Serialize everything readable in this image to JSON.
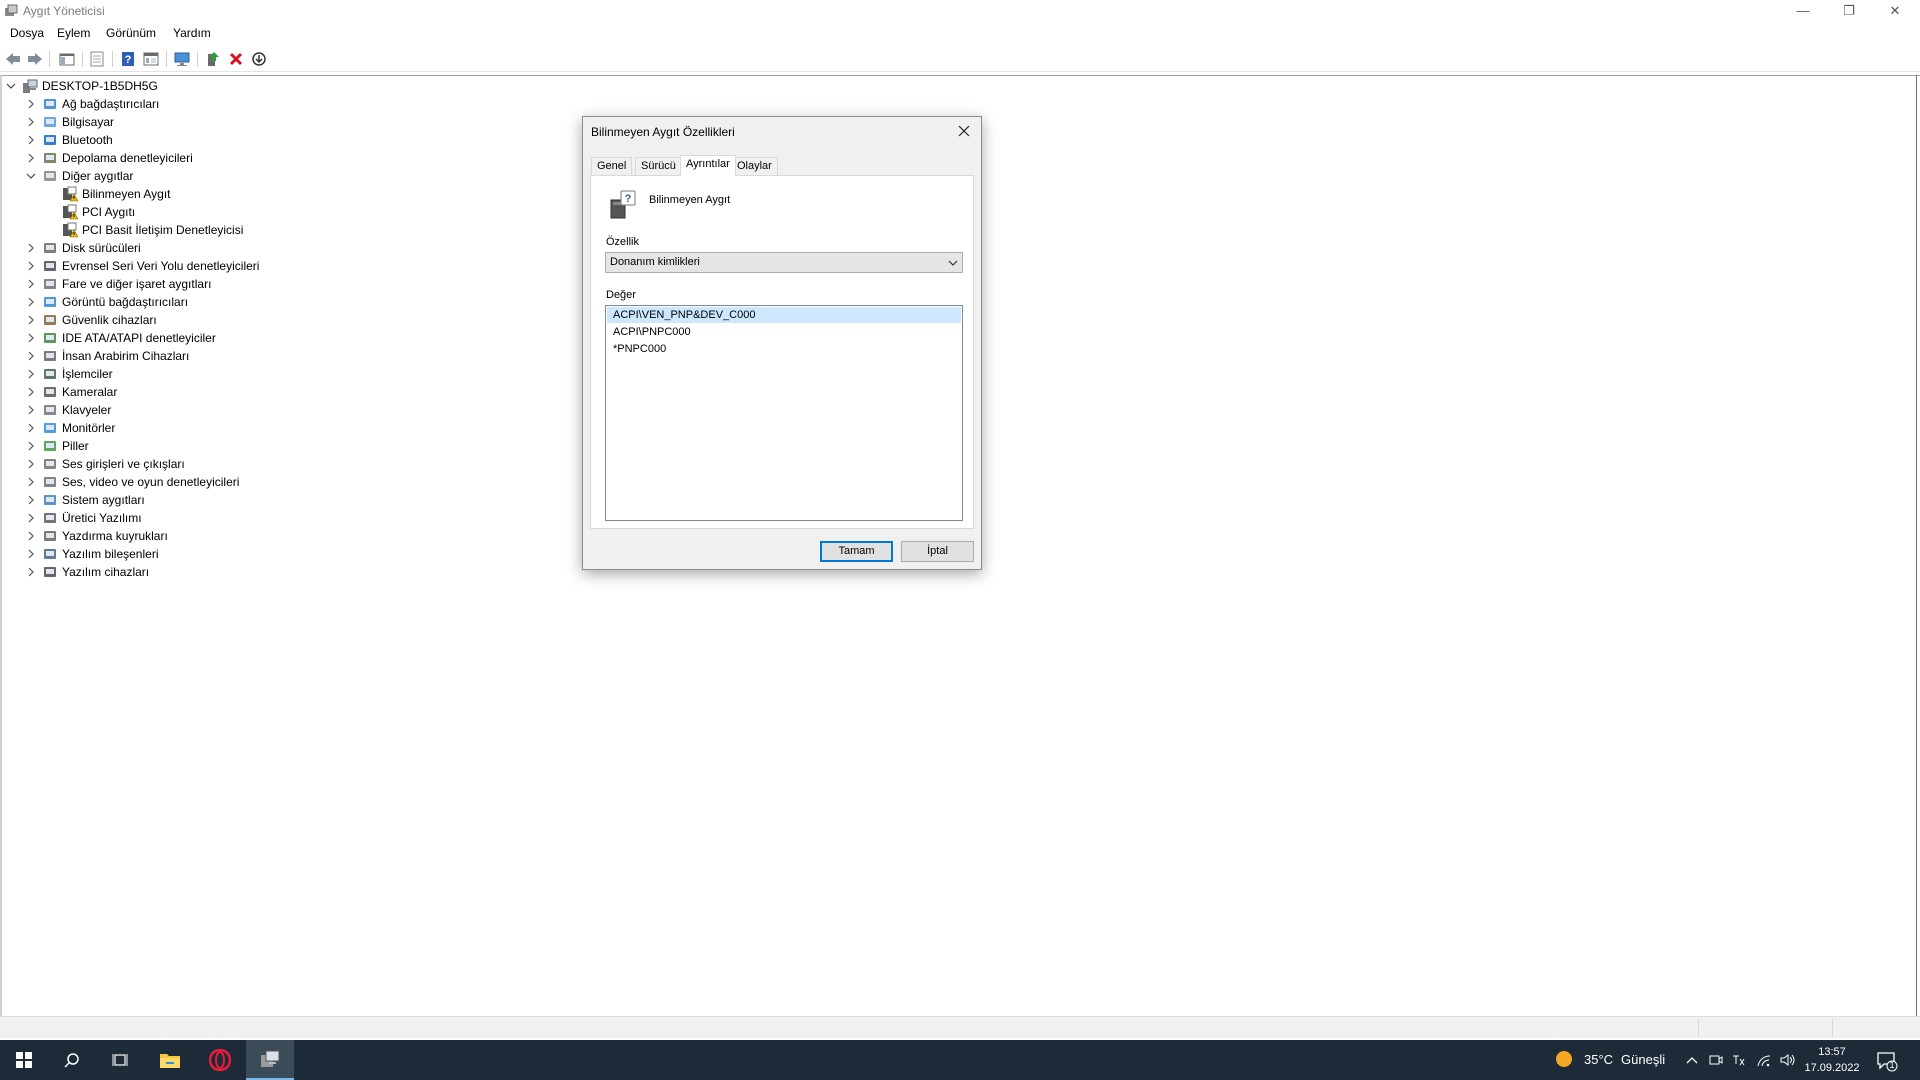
{
  "window": {
    "title": "Aygıt Yöneticisi"
  },
  "menu": [
    "Dosya",
    "Eylem",
    "Görünüm",
    "Yardım"
  ],
  "tree": {
    "root": "DESKTOP-1B5DH5G",
    "items": [
      {
        "label": "Ağ bağdaştırıcıları",
        "icon": "network-adapter-icon",
        "expanded": false
      },
      {
        "label": "Bilgisayar",
        "icon": "computer-icon",
        "expanded": false
      },
      {
        "label": "Bluetooth",
        "icon": "bluetooth-icon",
        "expanded": false
      },
      {
        "label": "Depolama denetleyicileri",
        "icon": "storage-controller-icon",
        "expanded": false
      },
      {
        "label": "Diğer aygıtlar",
        "icon": "other-devices-icon",
        "expanded": true,
        "children": [
          "Bilinmeyen Aygıt",
          "PCI Aygıtı",
          "PCI Basit İletişim Denetleyicisi"
        ]
      },
      {
        "label": "Disk sürücüleri",
        "icon": "disk-drive-icon",
        "expanded": false
      },
      {
        "label": "Evrensel Seri Veri Yolu denetleyicileri",
        "icon": "usb-icon",
        "expanded": false
      },
      {
        "label": "Fare ve diğer işaret aygıtları",
        "icon": "mouse-icon",
        "expanded": false
      },
      {
        "label": "Görüntü bağdaştırıcıları",
        "icon": "display-adapter-icon",
        "expanded": false
      },
      {
        "label": "Güvenlik cihazları",
        "icon": "security-device-icon",
        "expanded": false
      },
      {
        "label": "IDE ATA/ATAPI denetleyiciler",
        "icon": "ide-controller-icon",
        "expanded": false
      },
      {
        "label": "İnsan Arabirim Cihazları",
        "icon": "hid-icon",
        "expanded": false
      },
      {
        "label": "İşlemciler",
        "icon": "processor-icon",
        "expanded": false
      },
      {
        "label": "Kameralar",
        "icon": "camera-icon",
        "expanded": false
      },
      {
        "label": "Klavyeler",
        "icon": "keyboard-icon",
        "expanded": false
      },
      {
        "label": "Monitörler",
        "icon": "monitor-icon",
        "expanded": false
      },
      {
        "label": "Piller",
        "icon": "battery-icon",
        "expanded": false
      },
      {
        "label": "Ses girişleri ve çıkışları",
        "icon": "audio-io-icon",
        "expanded": false
      },
      {
        "label": "Ses, video ve oyun denetleyicileri",
        "icon": "sound-controller-icon",
        "expanded": false
      },
      {
        "label": "Sistem aygıtları",
        "icon": "system-device-icon",
        "expanded": false
      },
      {
        "label": "Üretici Yazılımı",
        "icon": "firmware-icon",
        "expanded": false
      },
      {
        "label": "Yazdırma kuyrukları",
        "icon": "print-queue-icon",
        "expanded": false
      },
      {
        "label": "Yazılım bileşenleri",
        "icon": "software-component-icon",
        "expanded": false
      },
      {
        "label": "Yazılım cihazları",
        "icon": "software-device-icon",
        "expanded": false
      }
    ]
  },
  "dialog": {
    "title": "Bilinmeyen Aygıt Özellikleri",
    "tabs": [
      "Genel",
      "Sürücü",
      "Ayrıntılar",
      "Olaylar"
    ],
    "active_tab": "Ayrıntılar",
    "device_name": "Bilinmeyen Aygıt",
    "property_label": "Özellik",
    "property_value": "Donanım kimlikleri",
    "value_label": "Değer",
    "values": [
      "ACPI\\VEN_PNP&DEV_C000",
      "ACPI\\PNPC000",
      "*PNPC000"
    ],
    "selected_value": 0,
    "ok_label": "Tamam",
    "cancel_label": "İptal"
  },
  "taskbar": {
    "weather": {
      "temp": "35°C",
      "condition": "Güneşli"
    },
    "time": "13:57",
    "date": "17.09.2022",
    "notification_count": "1"
  }
}
